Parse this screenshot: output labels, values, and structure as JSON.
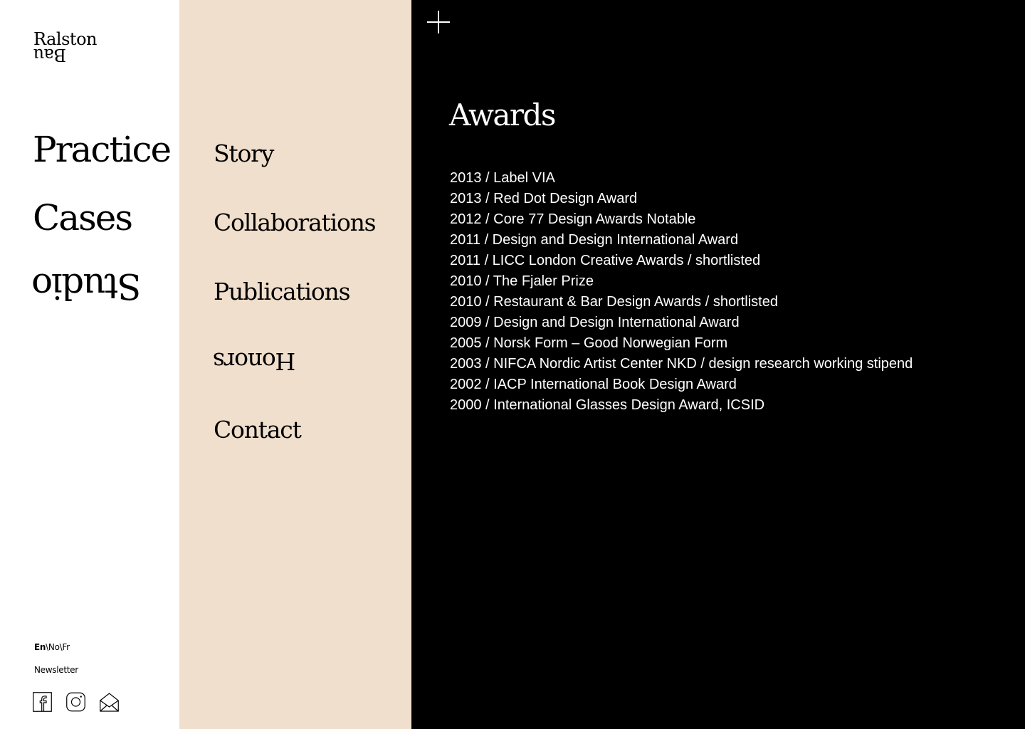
{
  "brand": {
    "logo_line1": "Ralston",
    "logo_line2": "Bau"
  },
  "primary_nav": {
    "items": [
      {
        "label": "Practice",
        "flipped": false
      },
      {
        "label": "Cases",
        "flipped": false
      },
      {
        "label": "Studio",
        "flipped": true,
        "active": true
      }
    ]
  },
  "secondary_nav": {
    "items": [
      {
        "label": "Story",
        "flipped": false
      },
      {
        "label": "Collaborations",
        "flipped": false
      },
      {
        "label": "Publications",
        "flipped": false
      },
      {
        "label": "Honors",
        "flipped": true,
        "active": true
      },
      {
        "label": "Contact",
        "flipped": false
      }
    ]
  },
  "footer": {
    "lang_active": "En",
    "lang_sep1": "\\",
    "lang_no": "No",
    "lang_sep2": "\\",
    "lang_fr": "Fr",
    "newsletter": "Newsletter",
    "icons": [
      "facebook-icon",
      "instagram-icon",
      "mail-icon"
    ]
  },
  "content": {
    "title": "Awards",
    "awards": [
      "2013 / Label VIA",
      "2013 / Red Dot Design Award",
      "2012 / Core 77 Design Awards Notable",
      "2011 / Design and Design International Award",
      "2011 / LICC London Creative Awards / shortlisted",
      "2010 / The Fjaler Prize",
      "2010 / Restaurant & Bar Design Awards / shortlisted",
      "2009 / Design and Design International Award",
      "2005 / Norsk Form – Good Norwegian Form",
      "2003 / NIFCA Nordic Artist Center NKD / design research working stipend",
      "2002 / IACP International Book Design Award",
      "2000 / International Glasses Design Award, ICSID"
    ]
  },
  "colors": {
    "primary_bg": "#ffffff",
    "secondary_bg": "#f0dfcc",
    "content_bg": "#000000",
    "content_text": "#ffffff"
  }
}
